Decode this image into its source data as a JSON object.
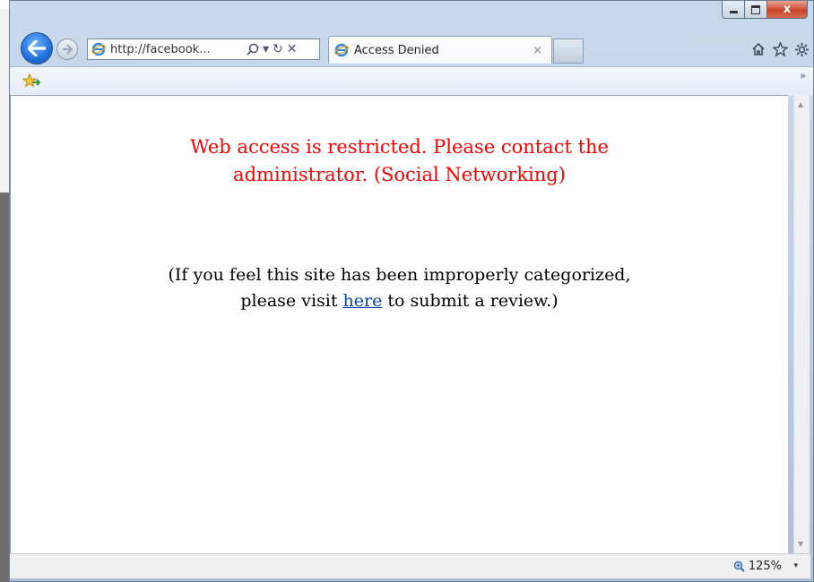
{
  "window": {
    "caption": {
      "minimize": "",
      "maximize": "",
      "close": "x"
    }
  },
  "nav": {
    "address_url": "http://facebook...",
    "search_icon": "search-icon",
    "dropdown_icon": "▾",
    "refresh_icon": "↻",
    "stop_icon": "✕"
  },
  "tabs": [
    {
      "title": "Access Denied",
      "close": "×"
    }
  ],
  "toolbar": {
    "favorites_more": "»"
  },
  "page": {
    "message_line1": "Web access is restricted. Please contact the",
    "message_line2": "administrator. (Social Networking)",
    "note_line1": "(If you feel this site has been improperly categorized,",
    "note_prefix": "please visit ",
    "note_link": "here",
    "note_suffix": " to submit a review.)"
  },
  "status": {
    "zoom": "125%",
    "zoom_dropdown": "▾"
  },
  "colors": {
    "message": "#ff0000",
    "link": "#0645ad"
  }
}
